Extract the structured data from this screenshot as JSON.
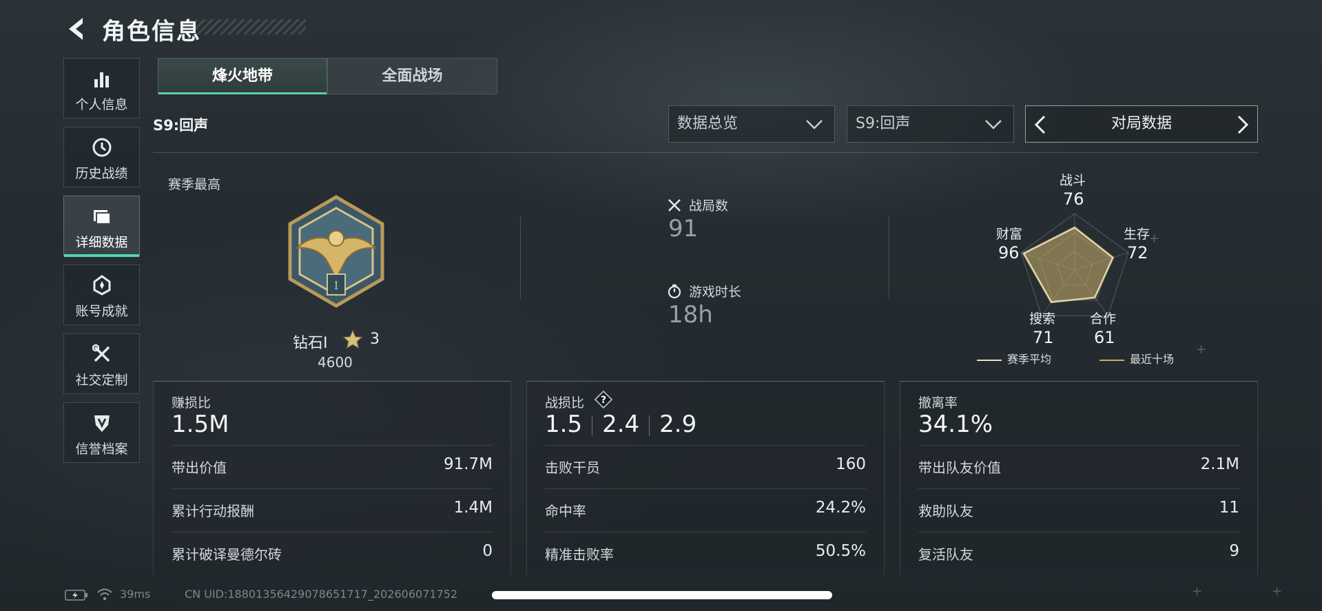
{
  "header": {
    "title": "角色信息"
  },
  "sidebar": {
    "items": [
      {
        "label": "个人信息",
        "icon": "bar-chart-icon"
      },
      {
        "label": "历史战绩",
        "icon": "clock-icon"
      },
      {
        "label": "详细数据",
        "icon": "folder-icon",
        "active": true
      },
      {
        "label": "账号成就",
        "icon": "badge-icon"
      },
      {
        "label": "社交定制",
        "icon": "tools-icon"
      },
      {
        "label": "信誉档案",
        "icon": "shield-icon"
      }
    ]
  },
  "tabs": [
    {
      "label": "烽火地带",
      "active": true
    },
    {
      "label": "全面战场",
      "active": false
    }
  ],
  "season_label": "S9:回声",
  "filters": {
    "overview": "数据总览",
    "season": "S9:回声",
    "pager": "对局数据"
  },
  "season_best": {
    "label": "赛季最高",
    "rank": "钻石I",
    "stars": "3",
    "score": "4600"
  },
  "match_stats": {
    "matches_label": "战局数",
    "matches_value": "91",
    "time_label": "游戏时长",
    "time_value": "18h"
  },
  "radar": {
    "axes": [
      {
        "name": "战斗",
        "value": "76"
      },
      {
        "name": "生存",
        "value": "72"
      },
      {
        "name": "合作",
        "value": "61"
      },
      {
        "name": "搜索",
        "value": "71"
      },
      {
        "name": "财富",
        "value": "96"
      }
    ],
    "legend_season": "赛季平均",
    "legend_recent": "最近十场",
    "color_season": "#e8e2c8",
    "color_recent": "#c9b06a"
  },
  "cards": {
    "profit": {
      "title": "赚损比",
      "big": "1.5M",
      "rows": [
        {
          "k": "带出价值",
          "v": "91.7M"
        },
        {
          "k": "累计行动报酬",
          "v": "1.4M"
        },
        {
          "k": "累计破译曼德尔砖",
          "v": "0"
        }
      ]
    },
    "combat": {
      "title": "战损比",
      "big": [
        "1.5",
        "2.4",
        "2.9"
      ],
      "rows": [
        {
          "k": "击败干员",
          "v": "160"
        },
        {
          "k": "命中率",
          "v": "24.2%"
        },
        {
          "k": "精准击败率",
          "v": "50.5%"
        }
      ]
    },
    "extract": {
      "title": "撤离率",
      "big": "34.1%",
      "rows": [
        {
          "k": "带出队友价值",
          "v": "2.1M"
        },
        {
          "k": "救助队友",
          "v": "11"
        },
        {
          "k": "复活队友",
          "v": "9"
        }
      ]
    }
  },
  "status_bar": {
    "ping": "39ms",
    "uid": "CN UID:18801356429078651717_202606071752"
  },
  "accent_color": "#4fd9a8"
}
